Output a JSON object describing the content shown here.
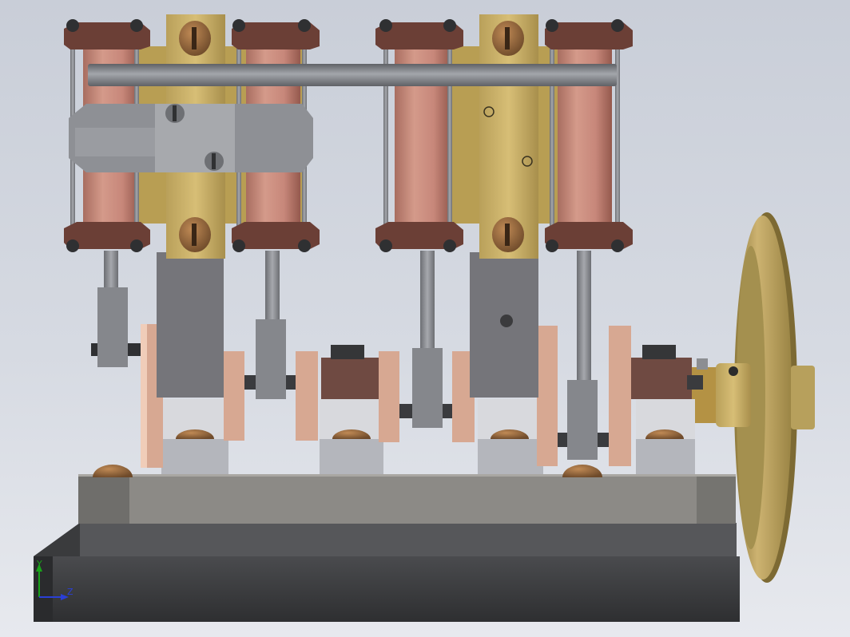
{
  "scene": {
    "subject": "four-cylinder-engine-model",
    "background_top": "#c9ced8",
    "background_bottom": "#e7e9ee"
  },
  "colors": {
    "cylinder_copper": "#c98b7c",
    "cylinder_copper_dark": "#9e5f52",
    "flange_brown": "#6a3f35",
    "brass": "#c8ad64",
    "brass_dark": "#9c8441",
    "steel": "#8d9096",
    "steel_light": "#b6b8bd",
    "base_dark": "#3c3d40",
    "crank_web": "#e3b7a0",
    "bearing_brown": "#6f4a42"
  },
  "triad": {
    "y_label": "Y",
    "z_label": "Z",
    "y_color": "#1aa31a",
    "z_color": "#2a3fd6"
  }
}
